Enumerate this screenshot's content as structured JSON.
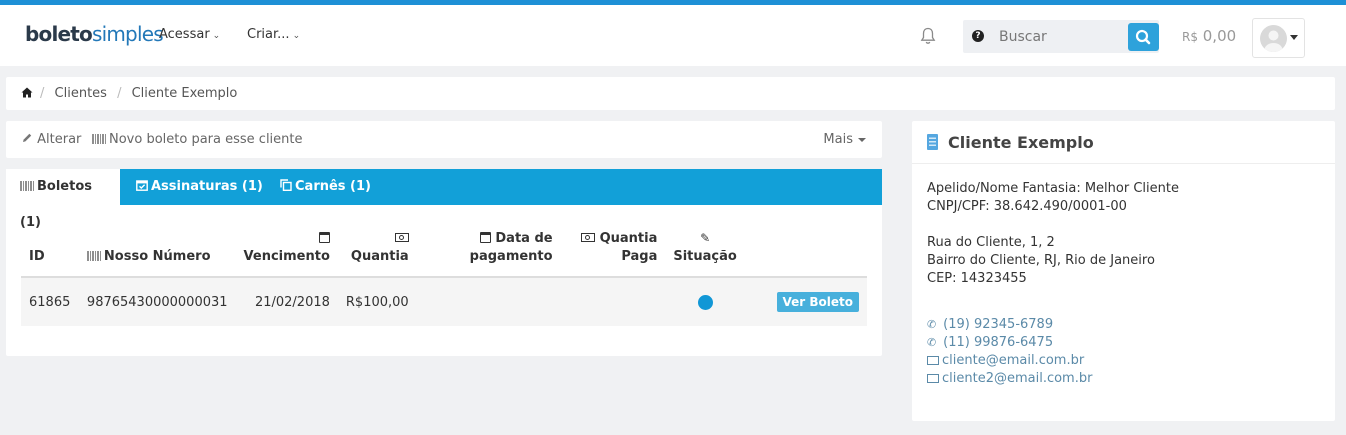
{
  "brand": {
    "part1": "boleto",
    "part2": "simples"
  },
  "nav": {
    "acessar": "Acessar",
    "criar": "Criar..."
  },
  "search": {
    "placeholder": "Buscar"
  },
  "balance": {
    "currency": "R$",
    "value": "0,00"
  },
  "breadcrumb": {
    "items": [
      "Clientes",
      "Cliente Exemplo"
    ]
  },
  "actions": {
    "alterar": "Alterar",
    "novo_boleto": "Novo boleto para esse cliente",
    "mais": "Mais"
  },
  "tabs": [
    {
      "label": "Boletos (1)",
      "icon": "barcode-icon",
      "active": true
    },
    {
      "label": "Assinaturas (1)",
      "icon": "calendar-check-icon",
      "active": false
    },
    {
      "label": "Carnês (1)",
      "icon": "copy-icon",
      "active": false
    }
  ],
  "table": {
    "headers": {
      "id": "ID",
      "nosso_numero": "Nosso Número",
      "vencimento": "Vencimento",
      "quantia": "Quantia",
      "data_pag_1": "Data de",
      "data_pag_2": "pagamento",
      "quantia_paga_1": "Quantia",
      "quantia_paga_2": "Paga",
      "situacao": "Situação"
    },
    "rows": [
      {
        "id": "61865",
        "nosso_numero": "98765430000000031",
        "vencimento": "21/02/2018",
        "quantia": "R$100,00",
        "data_pagamento": "",
        "quantia_paga": "",
        "situacao_color": "#1197d6",
        "action": "Ver Boleto"
      }
    ]
  },
  "client": {
    "name": "Cliente Exemplo",
    "apelido": "Apelido/Nome Fantasia: Melhor Cliente",
    "cnpj": "CNPJ/CPF: 38.642.490/0001-00",
    "address1": "Rua do Cliente, 1, 2",
    "address2": "Bairro do Cliente, RJ, Rio de Janeiro",
    "cep": "CEP: 14323455",
    "phones": [
      "(19) 92345-6789",
      "(11) 99876-6475"
    ],
    "emails": [
      "cliente@email.com.br",
      "cliente2@email.com.br"
    ]
  },
  "colors": {
    "accent": "#12a0d8",
    "topline": "#1e90d6",
    "button": "#47b0dc"
  }
}
